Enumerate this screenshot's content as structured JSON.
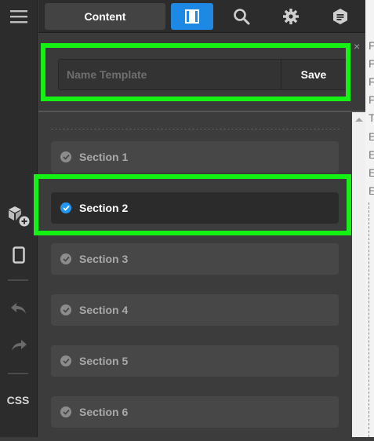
{
  "toolbar": {
    "content_tab_label": "Content",
    "icons": [
      "panel-icon",
      "search-icon",
      "gear-icon",
      "blocks-icon"
    ]
  },
  "rail": {
    "css_label": "CSS"
  },
  "template": {
    "name_placeholder": "Name Template",
    "save_label": "Save",
    "close_glyph": "×"
  },
  "sections": [
    {
      "label": "Section 1",
      "selected": false
    },
    {
      "label": "Section 2",
      "selected": true
    },
    {
      "label": "Section 3",
      "selected": false
    },
    {
      "label": "Section 4",
      "selected": false
    },
    {
      "label": "Section 5",
      "selected": false
    },
    {
      "label": "Section 6",
      "selected": false
    }
  ],
  "canvas_letters": [
    "F",
    "F",
    "F",
    "F",
    "T",
    "E",
    "E",
    "E",
    "E"
  ],
  "colors": {
    "accent": "#1e88e5",
    "highlight": "#14f214"
  }
}
